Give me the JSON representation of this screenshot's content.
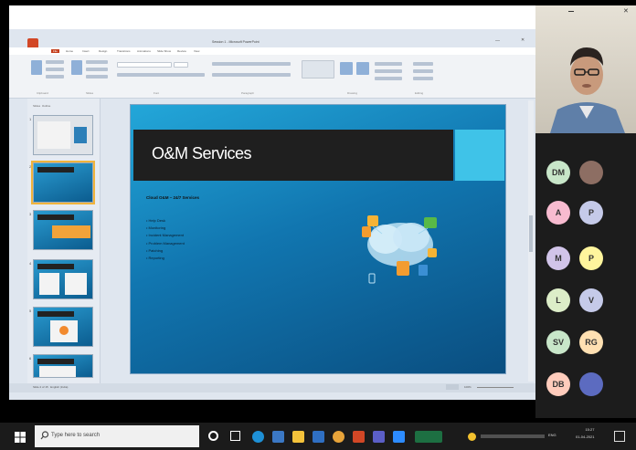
{
  "window": {
    "title": "Session 1 - Microsoft PowerPoint",
    "tabs": [
      "File",
      "Home",
      "Insert",
      "Design",
      "Transitions",
      "Animations",
      "Slide Show",
      "Review",
      "View"
    ]
  },
  "ribbon": {
    "groups": [
      "Clipboard",
      "Slides",
      "Font",
      "Paragraph",
      "Drawing",
      "Editing"
    ]
  },
  "thumbnails": {
    "pane_tabs": "Slides  Outline",
    "items": [
      "1",
      "2",
      "3",
      "4",
      "5",
      "6"
    ]
  },
  "slide": {
    "title": "O&M Services",
    "subtitle": "Cloud O&M – 24/7 Services",
    "bullets": [
      "Help Desk",
      "Monitoring",
      "Incident Management",
      "Problem Management",
      "Patching",
      "Reporting"
    ]
  },
  "status": {
    "left": "Slide 2 of 15   English (India)",
    "right": "100%"
  },
  "participants": [
    {
      "initials": "DM",
      "color": "#c8e6c9"
    },
    {
      "initials": "",
      "color": "#8d6e63"
    },
    {
      "initials": "A",
      "color": "#f8bbd0"
    },
    {
      "initials": "P",
      "color": "#c5cae9"
    },
    {
      "initials": "M",
      "color": "#d1c4e9"
    },
    {
      "initials": "P",
      "color": "#fff59d"
    },
    {
      "initials": "L",
      "color": "#dcedc8"
    },
    {
      "initials": "V",
      "color": "#c5cae9"
    },
    {
      "initials": "SV",
      "color": "#c8e6c9"
    },
    {
      "initials": "RG",
      "color": "#ffe0b2"
    },
    {
      "initials": "DB",
      "color": "#ffccbc"
    },
    {
      "initials": "",
      "color": "#5c6bc0"
    }
  ],
  "taskbar": {
    "search_placeholder": "Type here to search",
    "time": "15:27",
    "date": "01-04-2021",
    "lang": "ENG"
  }
}
